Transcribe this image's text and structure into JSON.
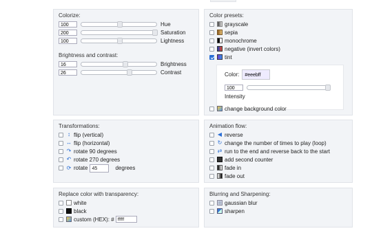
{
  "colorize": {
    "title": "Colorize:",
    "rows": [
      {
        "value": "100",
        "level": 0.5,
        "label": "Hue"
      },
      {
        "value": "200",
        "level": 1.0,
        "label": "Saturation"
      },
      {
        "value": "100",
        "level": 0.5,
        "label": "Lightness"
      }
    ],
    "bc_title": "Brightness and contrast:",
    "bc_rows": [
      {
        "value": "16",
        "level": 0.58,
        "label": "Brightness"
      },
      {
        "value": "26",
        "level": 0.63,
        "label": "Contrast"
      }
    ]
  },
  "presets": {
    "title": "Color presets:",
    "items": [
      {
        "label": "grayscale",
        "checked": false,
        "icon": "grayscale-icon"
      },
      {
        "label": "sepia",
        "checked": false,
        "icon": "sepia-icon"
      },
      {
        "label": "monochrome",
        "checked": false,
        "icon": "monochrome-icon"
      },
      {
        "label": "negative (invert colors)",
        "checked": false,
        "icon": "negative-icon"
      },
      {
        "label": "tint",
        "checked": true,
        "icon": "tint-icon"
      }
    ],
    "tint": {
      "color_label": "Color:",
      "color_value": "#eeebff",
      "intensity_value": "100",
      "intensity_level": 1.0,
      "intensity_label": "Intensity"
    },
    "bg_label": "change background color"
  },
  "transformations": {
    "title": "Transformations:",
    "items": [
      {
        "label": "flip (vertical)"
      },
      {
        "label": "flip (horizontal)"
      },
      {
        "label": "rotate 90 degrees"
      },
      {
        "label": "rotate 270 degrees"
      }
    ],
    "rotate_label": "rotate",
    "rotate_value": "45",
    "rotate_unit": "degrees"
  },
  "animation": {
    "title": "Animation flow:",
    "items": [
      {
        "label": "reverse"
      },
      {
        "label": "change the number of times to play (loop)"
      },
      {
        "label": "run to the end and reverse back to the start"
      },
      {
        "label": "add second counter"
      },
      {
        "label": "fade in"
      },
      {
        "label": "fade out"
      }
    ]
  },
  "transparency": {
    "title": "Replace color with transparency:",
    "items": [
      {
        "label": "white"
      },
      {
        "label": "black"
      }
    ],
    "custom_label": "custom (HEX): #",
    "custom_value": "ffffff"
  },
  "blur": {
    "title": "Blurring and Sharpening:",
    "items": [
      {
        "label": "gaussian blur"
      },
      {
        "label": "sharpen"
      }
    ]
  },
  "colors": {
    "accent": "#2a6fd6",
    "panel_bg": "#f2f4f7",
    "tint_swatch": "#eeebff"
  }
}
